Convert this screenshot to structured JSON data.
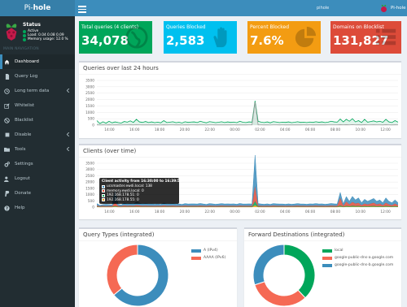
{
  "header": {
    "brand_prefix": "Pi-",
    "brand_suffix": "hole",
    "hostname": "pihole",
    "user": "Pi-hole"
  },
  "sidebar": {
    "status_title": "Status",
    "status_active": "Active",
    "status_load": "Load: 0.04 0.08 0.09",
    "status_memory": "Memory usage: 12.0 %",
    "section_title": "MAIN NAVIGATION",
    "items": [
      {
        "label": "Dashboard",
        "icon": "home-icon"
      },
      {
        "label": "Query Log",
        "icon": "file-icon"
      },
      {
        "label": "Long term data",
        "icon": "clock-icon"
      },
      {
        "label": "Whitelist",
        "icon": "pencil-icon"
      },
      {
        "label": "Blacklist",
        "icon": "ban-icon"
      },
      {
        "label": "Disable",
        "icon": "stop-icon"
      },
      {
        "label": "Tools",
        "icon": "folder-icon"
      },
      {
        "label": "Settings",
        "icon": "gears-icon"
      },
      {
        "label": "Logout",
        "icon": "user-icon"
      },
      {
        "label": "Donate",
        "icon": "paypal-icon"
      },
      {
        "label": "Help",
        "icon": "question-icon"
      }
    ]
  },
  "stats": {
    "total_label": "Total queries (4 clients)",
    "total_value": "34,078",
    "blocked_label": "Queries Blocked",
    "blocked_value": "2,583",
    "percent_label": "Percent Blocked",
    "percent_value": "7.6%",
    "domains_label": "Domains on Blocklist",
    "domains_value": "131,827",
    "colors": {
      "total": "#00a65a",
      "blocked": "#00c0ef",
      "percent": "#f39c12",
      "domains": "#dd4b39"
    }
  },
  "panels": {
    "queries_title": "Queries over last 24 hours",
    "clients_title": "Clients (over time)",
    "query_types_title": "Query Types (integrated)",
    "forward_title": "Forward Destinations (integrated)"
  },
  "tooltip": {
    "title": "Client activity from 16:30:00 to 16:39:59",
    "rows": [
      {
        "label": "ucsmaster.ewdi.local: 138",
        "color": "#3c8dbc"
      },
      {
        "label": "memory.ewdi.local: 0",
        "color": "#dd4b39"
      },
      {
        "label": "192.168.178.51: 0",
        "color": "#00a65a"
      },
      {
        "label": "192.168.178.55: 0",
        "color": "#f39c12"
      }
    ]
  },
  "chart_data": [
    {
      "type": "area",
      "title": "Queries over last 24 hours",
      "ylim": [
        0,
        3500
      ],
      "yticks": [
        "3500",
        "3000",
        "2500",
        "2000",
        "1500",
        "1000",
        "500",
        "0"
      ],
      "xticks": [
        "14:00",
        "16:00",
        "18:00",
        "20:00",
        "22:00",
        "00:00",
        "02:00",
        "04:00",
        "06:00",
        "08:00",
        "10:00",
        "12:00"
      ],
      "series": [
        {
          "color": "#00a65a",
          "values": [
            350,
            120,
            260,
            150,
            300,
            180,
            250,
            200,
            160,
            280,
            230,
            330,
            210,
            450,
            250,
            210,
            280,
            200,
            250,
            190,
            230,
            180,
            350,
            200,
            230,
            260,
            190,
            220,
            170,
            260,
            210,
            240,
            250,
            200,
            300,
            230,
            180,
            270,
            240,
            190,
            220,
            260,
            200,
            250,
            210,
            240,
            190,
            300,
            220,
            200,
            250,
            230,
            1900,
            300,
            230,
            200,
            250,
            180,
            270,
            240,
            200,
            230,
            210,
            250,
            190,
            220,
            260,
            210,
            230,
            200,
            240,
            210,
            260,
            220,
            250,
            200,
            230,
            300,
            250,
            230,
            470,
            250,
            450,
            300,
            500,
            250,
            350,
            200,
            450,
            230,
            280,
            330,
            250,
            300,
            220,
            450,
            250,
            200,
            350,
            230
          ]
        },
        {
          "color": "#999999",
          "values": [
            20,
            10,
            15,
            10,
            20,
            10,
            15,
            12,
            10,
            18,
            14,
            20,
            12,
            25,
            15,
            12,
            16,
            12,
            15,
            11,
            14,
            10,
            20,
            12,
            14,
            15,
            11,
            13,
            10,
            15,
            12,
            14,
            15,
            12,
            18,
            14,
            10,
            16,
            14,
            11,
            13,
            15,
            12,
            15,
            12,
            14,
            11,
            18,
            13,
            12,
            15,
            14,
            1800,
            18,
            14,
            12,
            15,
            10,
            16,
            14,
            12,
            14,
            12,
            15,
            11,
            13,
            15,
            12,
            14,
            12,
            14,
            12,
            15,
            13,
            15,
            12,
            14,
            18,
            15,
            14,
            28,
            15,
            27,
            18,
            30,
            15,
            21,
            12,
            27,
            14,
            17,
            20,
            15,
            18,
            13,
            27,
            15,
            12,
            21,
            14
          ]
        }
      ]
    },
    {
      "type": "area",
      "title": "Clients (over time)",
      "ylim": [
        0,
        3500
      ],
      "yticks": [
        "3500",
        "3000",
        "2500",
        "2000",
        "1500",
        "1000",
        "500",
        "0"
      ],
      "xticks": [
        "14:00",
        "16:00",
        "18:00",
        "20:00",
        "22:00",
        "00:00",
        "02:00",
        "04:00",
        "06:00",
        "08:00",
        "10:00",
        "12:00"
      ],
      "series": [
        {
          "name": "ucsmaster.ewdi.local",
          "color": "#3c8dbc",
          "values": [
            150,
            80,
            100,
            150,
            120,
            100,
            900,
            140,
            100,
            200,
            150,
            180,
            150,
            250,
            200,
            150,
            180,
            150,
            160,
            140,
            150,
            130,
            200,
            150,
            160,
            170,
            140,
            150,
            130,
            170,
            150,
            160,
            160,
            150,
            180,
            150,
            130,
            170,
            160,
            140,
            150,
            170,
            150,
            160,
            150,
            160,
            140,
            180,
            150,
            150,
            160,
            150,
            2500,
            170,
            150,
            140,
            160,
            130,
            170,
            160,
            150,
            150,
            140,
            160,
            140,
            150,
            170,
            150,
            150,
            140,
            160,
            150,
            170,
            150,
            160,
            140,
            150,
            180,
            160,
            150,
            450,
            160,
            400,
            250,
            450,
            300,
            400,
            200,
            350,
            250,
            300,
            350,
            250,
            300,
            200,
            400,
            250,
            200,
            300,
            200
          ]
        },
        {
          "name": "memory.ewdi.local",
          "color": "#dd4b39",
          "values": [
            100,
            50,
            80,
            60,
            70,
            60,
            300,
            70,
            60,
            100,
            80,
            90,
            80,
            120,
            100,
            80,
            90,
            80,
            80,
            70,
            80,
            70,
            100,
            80,
            80,
            90,
            70,
            80,
            70,
            90,
            80,
            80,
            80,
            80,
            90,
            80,
            70,
            90,
            80,
            70,
            80,
            90,
            80,
            80,
            80,
            80,
            70,
            90,
            80,
            80,
            80,
            80,
            1200,
            90,
            80,
            70,
            80,
            70,
            90,
            80,
            80,
            80,
            70,
            80,
            70,
            80,
            90,
            80,
            80,
            70,
            80,
            80,
            90,
            80,
            80,
            70,
            80,
            90,
            80,
            80,
            600,
            80,
            350,
            150,
            300,
            200,
            250,
            100,
            200,
            150,
            200,
            250,
            150,
            200,
            100,
            250,
            150,
            100,
            200,
            100
          ]
        },
        {
          "name": "192.168.178.51",
          "color": "#00a65a",
          "values": [
            20,
            10,
            15,
            10,
            12,
            10,
            50,
            12,
            10,
            18,
            14,
            16,
            14,
            22,
            18,
            14,
            16,
            14,
            14,
            12,
            14,
            12,
            18,
            14,
            14,
            15,
            12,
            14,
            12,
            15,
            14,
            14,
            14,
            14,
            16,
            14,
            12,
            15,
            14,
            12,
            14,
            15,
            14,
            14,
            14,
            14,
            12,
            16,
            14,
            14,
            14,
            14,
            300,
            15,
            14,
            12,
            14,
            12,
            15,
            14,
            14,
            14,
            12,
            14,
            12,
            14,
            15,
            14,
            14,
            12,
            14,
            14,
            15,
            14,
            14,
            12,
            14,
            16,
            14,
            14,
            80,
            14,
            60,
            40,
            70,
            50,
            60,
            30,
            50,
            40,
            50,
            60,
            40,
            50,
            30,
            60,
            40,
            30,
            50,
            30
          ]
        },
        {
          "name": "192.168.178.55",
          "color": "#f39c12",
          "values": [
            10,
            5,
            8,
            5,
            6,
            5,
            30,
            6,
            5,
            9,
            7,
            8,
            7,
            11,
            9,
            7,
            8,
            7,
            7,
            6,
            7,
            6,
            9,
            7,
            7,
            8,
            6,
            7,
            6,
            8,
            7,
            7,
            7,
            7,
            8,
            7,
            6,
            8,
            7,
            6,
            7,
            8,
            7,
            7,
            7,
            7,
            6,
            8,
            7,
            7,
            7,
            7,
            150,
            8,
            7,
            6,
            7,
            6,
            8,
            7,
            7,
            7,
            6,
            7,
            6,
            7,
            8,
            7,
            7,
            6,
            7,
            7,
            8,
            7,
            7,
            6,
            7,
            8,
            7,
            7,
            40,
            7,
            30,
            20,
            35,
            25,
            30,
            15,
            25,
            20,
            25,
            30,
            20,
            25,
            15,
            30,
            20,
            15,
            25,
            15
          ]
        }
      ]
    },
    {
      "type": "pie",
      "title": "Query Types (integrated)",
      "labels": [
        "A (IPv4)",
        "AAAA (IPv6)"
      ],
      "values": [
        64,
        36
      ],
      "colors": [
        "#3c8dbc",
        "#f56954"
      ]
    },
    {
      "type": "pie",
      "title": "Forward Destinations (integrated)",
      "labels": [
        "local",
        "google-public-dns-a.google.com",
        "google-public-dns-b.google.com"
      ],
      "values": [
        38,
        32,
        30
      ],
      "colors": [
        "#00a65a",
        "#f56954",
        "#3c8dbc"
      ]
    }
  ]
}
